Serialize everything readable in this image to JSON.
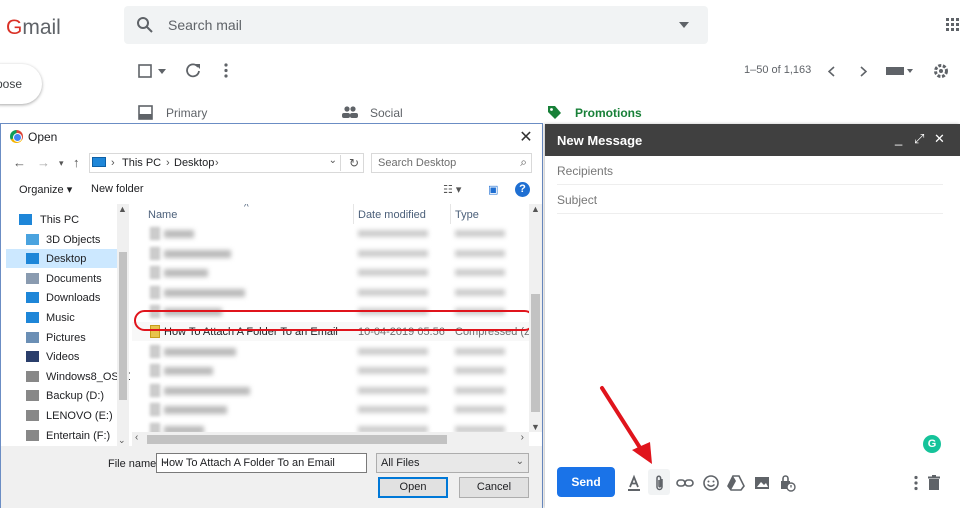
{
  "gmail": {
    "logo_text": "Gmail",
    "search_placeholder": "Search mail",
    "compose_label": "Compose",
    "compose_visible": "pose",
    "pager": "1–50 of 1,163",
    "tabs": [
      {
        "label": "Primary"
      },
      {
        "label": "Social"
      },
      {
        "label": "Promotions"
      }
    ]
  },
  "dialog": {
    "title": "Open",
    "breadcrumb": [
      "This PC",
      "Desktop"
    ],
    "search_placeholder": "Search Desktop",
    "organize_label": "Organize ▾",
    "new_folder_label": "New folder",
    "nav_items": [
      {
        "label": "This PC",
        "icon": "computer-icon",
        "selected": false
      },
      {
        "label": "3D Objects",
        "icon": "cube-icon",
        "selected": false
      },
      {
        "label": "Desktop",
        "icon": "desktop-icon",
        "selected": true
      },
      {
        "label": "Documents",
        "icon": "document-icon",
        "selected": false
      },
      {
        "label": "Downloads",
        "icon": "download-icon",
        "selected": false
      },
      {
        "label": "Music",
        "icon": "music-icon",
        "selected": false
      },
      {
        "label": "Pictures",
        "icon": "pictures-icon",
        "selected": false
      },
      {
        "label": "Videos",
        "icon": "videos-icon",
        "selected": false
      },
      {
        "label": "Windows8_OS (C",
        "icon": "drive-icon",
        "selected": false
      },
      {
        "label": "Backup (D:)",
        "icon": "drive-icon",
        "selected": false
      },
      {
        "label": "LENOVO (E:)",
        "icon": "drive-icon",
        "selected": false
      },
      {
        "label": "Entertain (F:)",
        "icon": "drive-icon",
        "selected": false
      }
    ],
    "columns": {
      "name": "Name",
      "date": "Date modified",
      "type": "Type"
    },
    "highlighted_file": {
      "name": "How To Attach A Folder To an Email",
      "date": "10-04-2019 05:56",
      "type": "Compressed (zipp"
    },
    "blurred_rows_before": 5,
    "blurred_rows_after": 6,
    "file_name_label": "File name:",
    "file_name_value": "How To Attach A Folder To an Email",
    "filter_value": "All Files",
    "open_label": "Open",
    "cancel_label": "Cancel"
  },
  "new_message": {
    "title": "New Message",
    "recipients_placeholder": "Recipients",
    "subject_placeholder": "Subject",
    "send_label": "Send",
    "grammarly_label": "G"
  },
  "colors": {
    "gmail_red": "#d93025",
    "send_blue": "#1a73e8",
    "promotions_green": "#188038",
    "annotation_red": "#e0141c",
    "compose_header": "#404040"
  }
}
